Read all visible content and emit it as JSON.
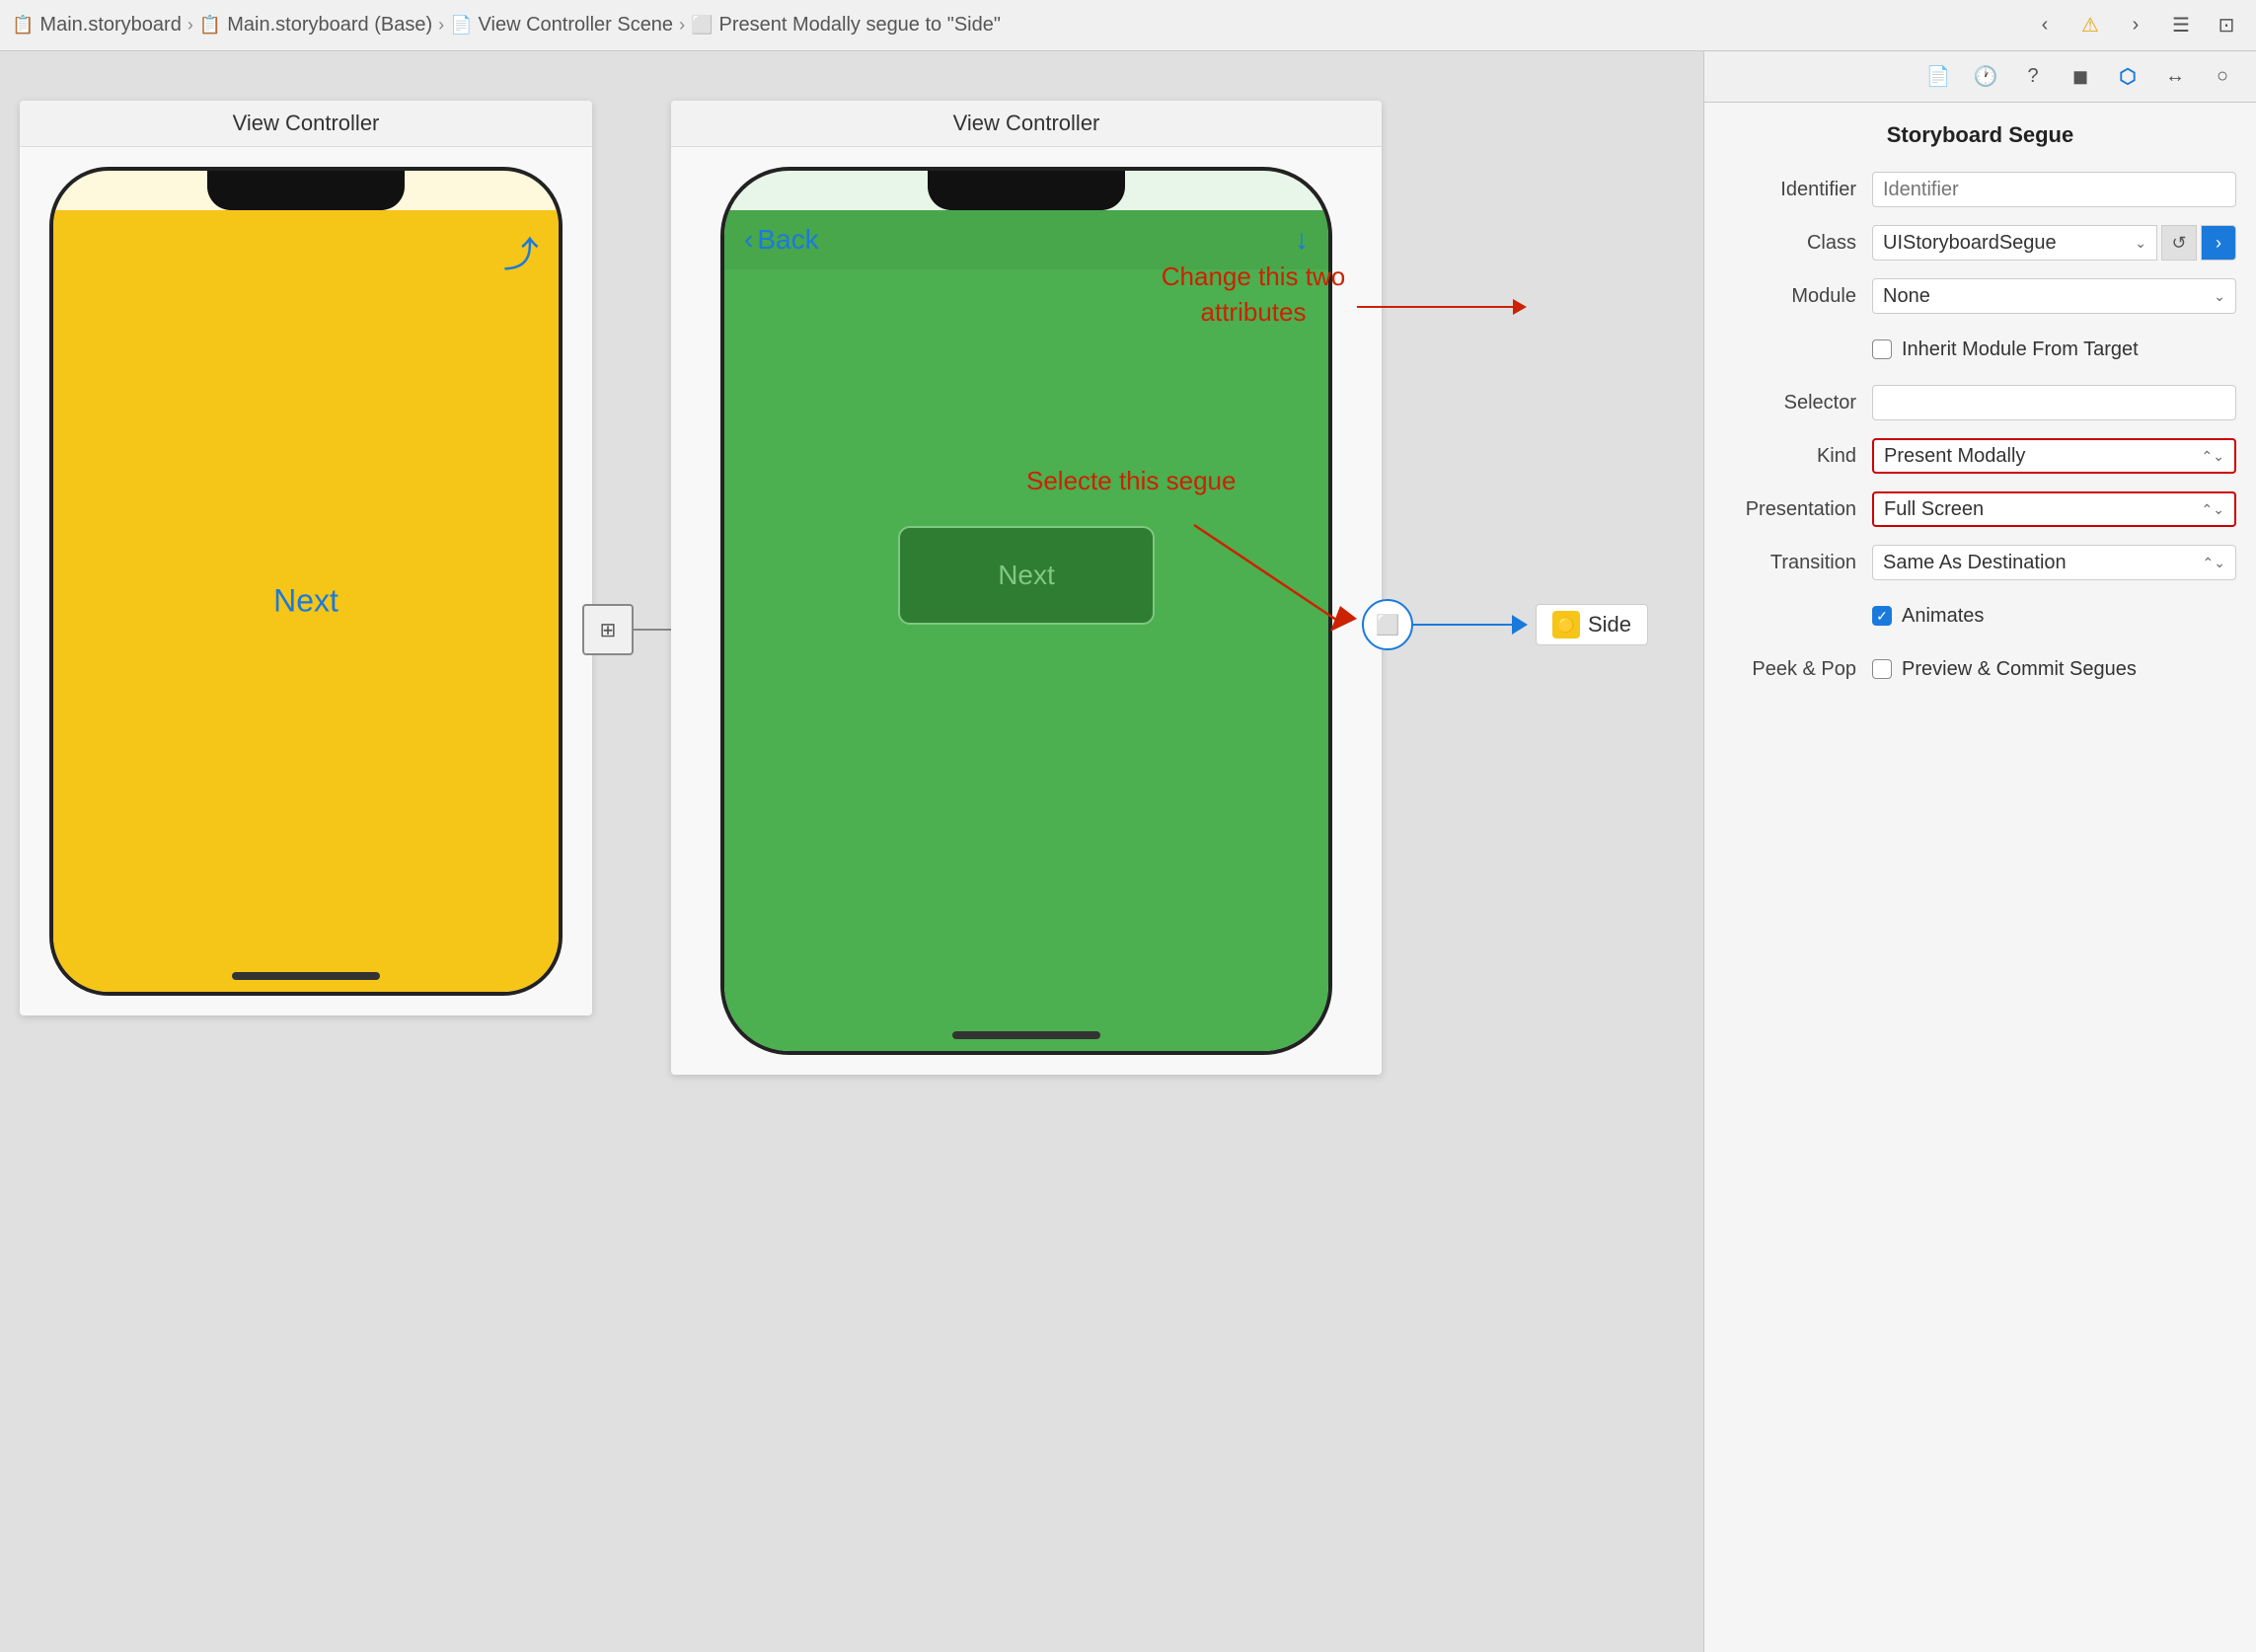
{
  "topbar": {
    "breadcrumb": [
      {
        "label": "Main.storyboard",
        "icon": "storyboard-icon"
      },
      {
        "label": "Main.storyboard (Base)",
        "icon": "storyboard-base-icon"
      },
      {
        "label": "View Controller Scene",
        "icon": "scene-icon"
      },
      {
        "label": "Present Modally segue to \"Side\"",
        "icon": "segue-icon"
      }
    ],
    "nav": {
      "back": "<",
      "warning": "⚠",
      "forward": ">"
    }
  },
  "left_vc": {
    "title": "View Controller",
    "next_label": "Next",
    "share_icon": "↑"
  },
  "center_vc": {
    "title": "View Controller",
    "back_label": "Back",
    "next_label": "Next",
    "nav_icon": "↓"
  },
  "segue_labels": {
    "side": "Side",
    "select_annotation": "Selecte this segue",
    "change_annotation": "Change this two attributes"
  },
  "inspector": {
    "title": "Storyboard Segue",
    "rows": [
      {
        "label": "Identifier",
        "type": "text_input",
        "placeholder": "Identifier",
        "value": ""
      },
      {
        "label": "Class",
        "type": "class_select",
        "value": "UIStoryboardSegue"
      },
      {
        "label": "Module",
        "type": "module_select",
        "value": "None"
      },
      {
        "label": "Inherit Module From Target",
        "type": "checkbox",
        "checked": false
      },
      {
        "label": "Selector",
        "type": "text_input",
        "placeholder": "",
        "value": ""
      },
      {
        "label": "Kind",
        "type": "select",
        "value": "Present Modally",
        "highlighted": true
      },
      {
        "label": "Presentation",
        "type": "select",
        "value": "Full Screen",
        "highlighted": true
      },
      {
        "label": "Transition",
        "type": "select",
        "value": "Same As Destination",
        "highlighted": false
      },
      {
        "label": "Animates",
        "type": "checkbox_only",
        "checked": true
      },
      {
        "label": "Peek & Pop",
        "type": "checkbox_text",
        "checked": false,
        "text": "Preview & Commit Segues"
      }
    ]
  }
}
